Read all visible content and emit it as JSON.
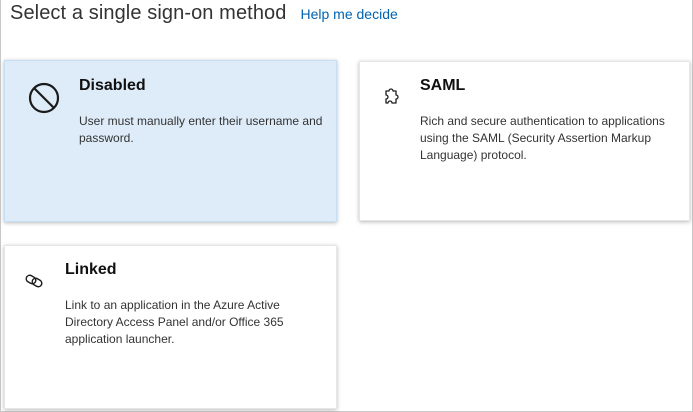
{
  "header": {
    "title": "Select a single sign-on method",
    "help_link": "Help me decide"
  },
  "methods": [
    {
      "title": "Disabled",
      "description": "User must manually enter their username and password.",
      "icon": "disabled-icon",
      "selected": true
    },
    {
      "title": "SAML",
      "description": "Rich and secure authentication to applications using the SAML (Security Assertion Markup Language) protocol.",
      "icon": "puzzle-icon",
      "selected": false
    },
    {
      "title": "Linked",
      "description": "Link to an application in the Azure Active Directory Access Panel and/or Office 365 application launcher.",
      "icon": "link-icon",
      "selected": false
    }
  ],
  "colors": {
    "link": "#0063b1",
    "selected_card_bg": "#deecf9"
  }
}
